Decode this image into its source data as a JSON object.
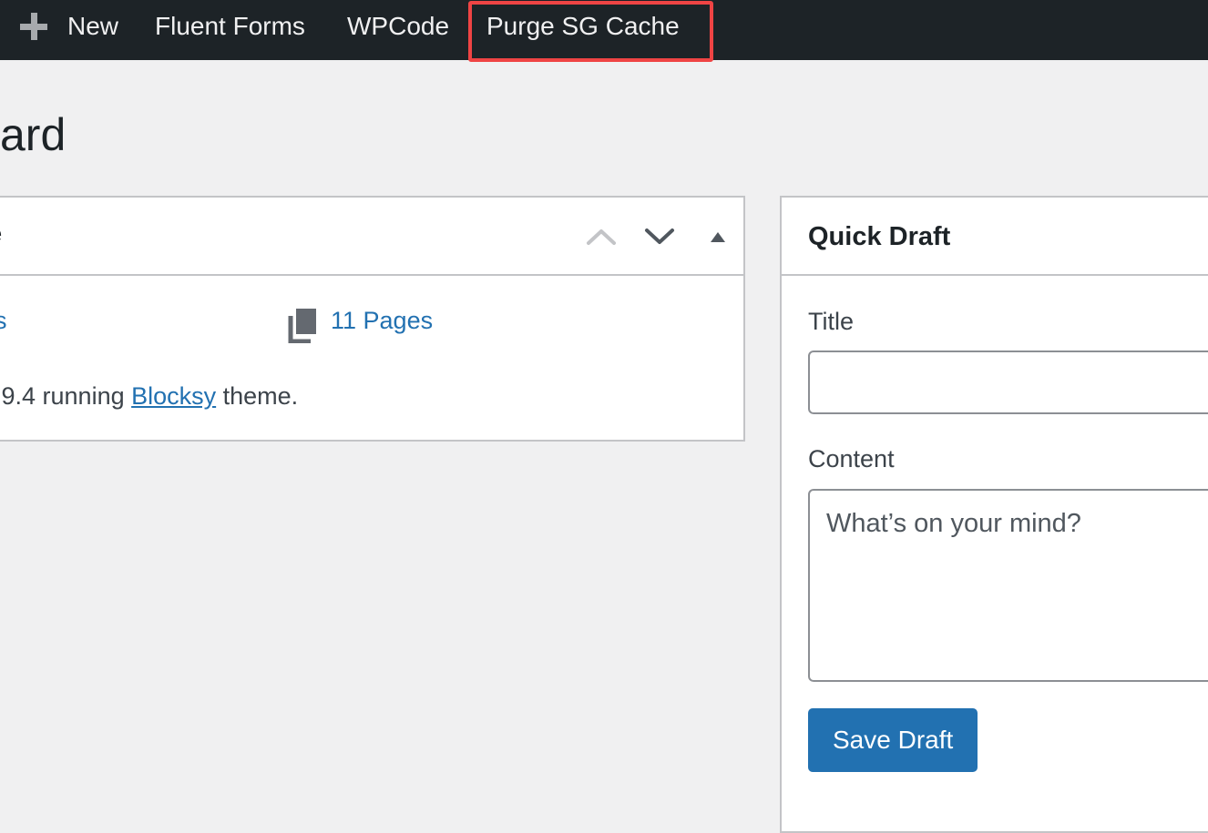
{
  "admin_bar": {
    "new_label": "New",
    "fluent_forms_label": "Fluent Forms",
    "wpcode_label": "WPCode",
    "purge_label": "Purge SG Cache"
  },
  "page": {
    "title_fragment": "ard"
  },
  "at_a_glance": {
    "title_fragment": "e",
    "posts_fragment": "s",
    "pages_label": "11 Pages",
    "version_prefix": ".9.4 running ",
    "theme_link": "Blocksy",
    "version_suffix": " theme."
  },
  "quick_draft": {
    "title": "Quick Draft",
    "title_label": "Title",
    "title_value": "",
    "content_label": "Content",
    "content_placeholder": "What’s on your mind?",
    "save_label": "Save Draft"
  },
  "colors": {
    "admin_bar_bg": "#1d2327",
    "highlight": "#ef4444",
    "link": "#2271b1",
    "primary_button": "#2271b1"
  }
}
